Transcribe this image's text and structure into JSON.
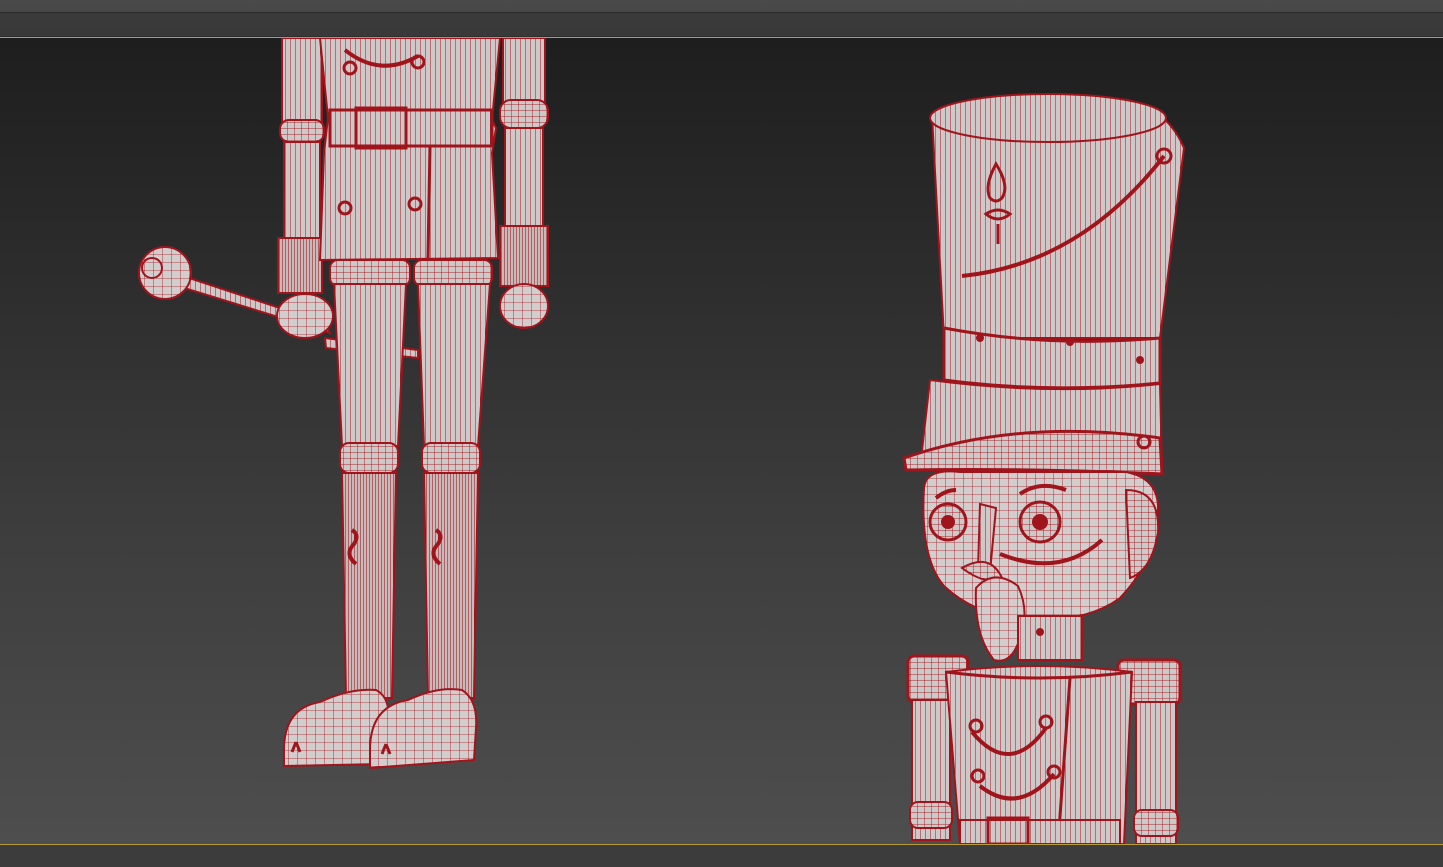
{
  "app": {
    "viewport_label": "",
    "viewport_border_color": "#b89a3a",
    "wire_color": "#b0111a",
    "mesh_fill_color": "#c9c4c4"
  },
  "scene": {
    "objects": [
      {
        "name": "nutcracker-legs"
      },
      {
        "name": "nutcracker-head"
      }
    ]
  }
}
